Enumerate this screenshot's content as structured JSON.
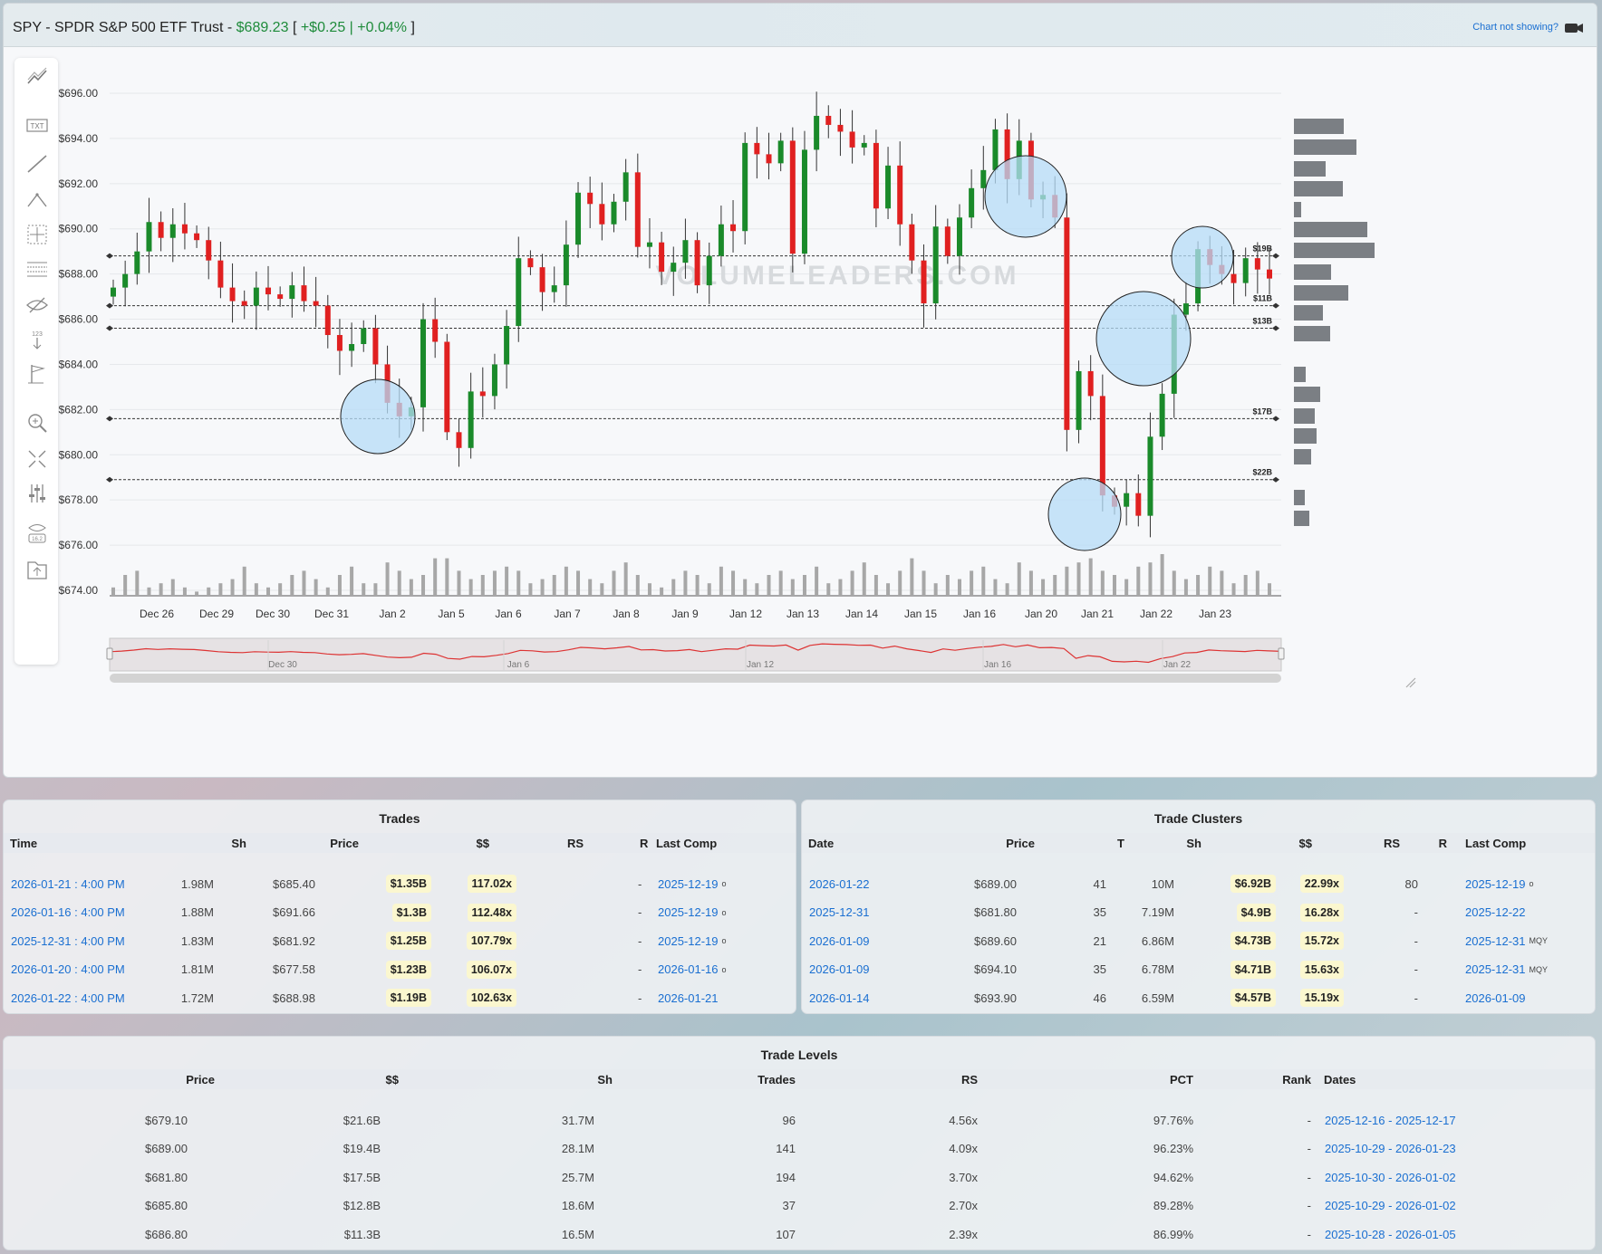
{
  "chart": {
    "symbol": "SPY",
    "name": "SPDR S&P 500 ETF Trust",
    "price": "$689.23",
    "change": "+$0.25",
    "change_pct": "+0.04%",
    "not_showing": "Chart not showing?",
    "watermark": "VOLUMELEADERS.COM",
    "colors": {
      "up": "#1a8a2a",
      "down": "#e02020",
      "bubble": "#b6dcf7",
      "volume": "#a7a7a7"
    }
  },
  "toolbar": [
    "trend-icon",
    "text-icon",
    "line-icon",
    "abc-pattern-icon",
    "crosshair-icon",
    "fib-lines-icon",
    "hide-eye-icon",
    "count-icon",
    "flag-icon",
    "zoom-icon",
    "fullscreen-icon",
    "settings-icon",
    "eye-value-icon",
    "export-icon"
  ],
  "chart_data": {
    "type": "candlestick",
    "y_ticks": [
      "$696.00",
      "$694.00",
      "$692.00",
      "$690.00",
      "$688.00",
      "$686.00",
      "$684.00",
      "$682.00",
      "$680.00",
      "$678.00",
      "$676.00",
      "$674.00"
    ],
    "ylim": [
      674,
      697
    ],
    "x_labels": [
      "Dec 26",
      "Dec 29",
      "Dec 30",
      "Dec 31",
      "Jan 2",
      "Jan 5",
      "Jan 6",
      "Jan 7",
      "Jan 8",
      "Jan 9",
      "Jan 12",
      "Jan 13",
      "Jan 14",
      "Jan 15",
      "Jan 16",
      "Jan 20",
      "Jan 21",
      "Jan 22",
      "Jan 23"
    ],
    "navigator_labels": [
      "Dec 30",
      "Jan 6",
      "Jan 12",
      "Jan 16",
      "Jan 22"
    ],
    "levels": [
      {
        "price": 688.8,
        "label": "$19B"
      },
      {
        "price": 686.6,
        "label": "$11B"
      },
      {
        "price": 685.6,
        "label": "$13B"
      },
      {
        "price": 681.6,
        "label": "$17B"
      },
      {
        "price": 678.9,
        "label": "$22B"
      }
    ],
    "closes": [
      687.4,
      688.0,
      689.0,
      690.3,
      689.6,
      690.2,
      689.8,
      689.5,
      688.6,
      687.4,
      686.8,
      686.6,
      687.4,
      687.1,
      686.9,
      687.5,
      686.8,
      686.6,
      685.3,
      684.6,
      684.9,
      685.6,
      684.0,
      682.3,
      681.7,
      682.1,
      686.0,
      685.0,
      681.0,
      680.3,
      682.8,
      682.6,
      684.0,
      685.7,
      688.7,
      688.3,
      687.2,
      687.5,
      689.3,
      691.6,
      691.1,
      690.2,
      691.2,
      692.5,
      689.2,
      689.4,
      688.1,
      688.5,
      689.5,
      687.5,
      688.8,
      690.2,
      689.9,
      693.8,
      693.3,
      692.9,
      693.9,
      688.9,
      693.5,
      695.0,
      694.6,
      694.3,
      693.6,
      693.8,
      690.9,
      692.8,
      690.2,
      688.6,
      686.7,
      690.1,
      688.8,
      690.5,
      691.8,
      692.6,
      694.4,
      692.2,
      693.9,
      691.3,
      691.5,
      690.5,
      681.1,
      683.7,
      682.6,
      678.2,
      677.7,
      678.3,
      677.3,
      680.8,
      682.7,
      686.2,
      686.7,
      689.1,
      688.4,
      688.0,
      687.6,
      688.7,
      688.2,
      687.8
    ],
    "volumes": [
      0.2,
      0.5,
      0.6,
      0.2,
      0.3,
      0.4,
      0.2,
      0.1,
      0.2,
      0.3,
      0.4,
      0.7,
      0.3,
      0.2,
      0.3,
      0.5,
      0.6,
      0.4,
      0.2,
      0.5,
      0.7,
      0.3,
      0.3,
      0.8,
      0.6,
      0.4,
      0.5,
      0.9,
      0.9,
      0.6,
      0.4,
      0.5,
      0.6,
      0.7,
      0.6,
      0.3,
      0.4,
      0.5,
      0.7,
      0.6,
      0.4,
      0.3,
      0.6,
      0.8,
      0.5,
      0.3,
      0.2,
      0.4,
      0.6,
      0.5,
      0.3,
      0.7,
      0.6,
      0.4,
      0.3,
      0.5,
      0.6,
      0.4,
      0.5,
      0.7,
      0.3,
      0.4,
      0.6,
      0.8,
      0.5,
      0.3,
      0.6,
      0.9,
      0.6,
      0.3,
      0.5,
      0.4,
      0.6,
      0.7,
      0.4,
      0.3,
      0.8,
      0.6,
      0.4,
      0.5,
      0.7,
      0.8,
      0.9,
      0.6,
      0.5,
      0.4,
      0.7,
      0.8,
      1.0,
      0.6,
      0.4,
      0.5,
      0.7,
      0.6,
      0.3,
      0.5,
      0.6,
      0.3
    ]
  },
  "trades": {
    "title": "Trades",
    "headers": [
      "Time",
      "Sh",
      "Price",
      "$$",
      "RS",
      "R",
      "Last Comp"
    ],
    "rows": [
      [
        "2026-01-21 : 4:00 PM",
        "1.98M",
        "$685.40",
        "$1.35B",
        "117.02x",
        "-",
        "2025-12-19",
        "o"
      ],
      [
        "2026-01-16 : 4:00 PM",
        "1.88M",
        "$691.66",
        "$1.3B",
        "112.48x",
        "-",
        "2025-12-19",
        "o"
      ],
      [
        "2025-12-31 : 4:00 PM",
        "1.83M",
        "$681.92",
        "$1.25B",
        "107.79x",
        "-",
        "2025-12-19",
        "o"
      ],
      [
        "2026-01-20 : 4:00 PM",
        "1.81M",
        "$677.58",
        "$1.23B",
        "106.07x",
        "-",
        "2026-01-16",
        "o"
      ],
      [
        "2026-01-22 : 4:00 PM",
        "1.72M",
        "$688.98",
        "$1.19B",
        "102.63x",
        "-",
        "2026-01-21",
        ""
      ]
    ]
  },
  "clusters": {
    "title": "Trade Clusters",
    "headers": [
      "Date",
      "Price",
      "T",
      "Sh",
      "$$",
      "RS",
      "R",
      "Last Comp"
    ],
    "rows": [
      [
        "2026-01-22",
        "$689.00",
        "41",
        "10M",
        "$6.92B",
        "22.99x",
        "80",
        "2025-12-19",
        "o"
      ],
      [
        "2025-12-31",
        "$681.80",
        "35",
        "7.19M",
        "$4.9B",
        "16.28x",
        "-",
        "2025-12-22",
        ""
      ],
      [
        "2026-01-09",
        "$689.60",
        "21",
        "6.86M",
        "$4.73B",
        "15.72x",
        "-",
        "2025-12-31",
        "MQY"
      ],
      [
        "2026-01-09",
        "$694.10",
        "35",
        "6.78M",
        "$4.71B",
        "15.63x",
        "-",
        "2025-12-31",
        "MQY"
      ],
      [
        "2026-01-14",
        "$693.90",
        "46",
        "6.59M",
        "$4.57B",
        "15.19x",
        "-",
        "2026-01-09",
        ""
      ]
    ]
  },
  "levels": {
    "title": "Trade Levels",
    "headers": [
      "Price",
      "$$",
      "Sh",
      "Trades",
      "RS",
      "PCT",
      "Rank",
      "Dates"
    ],
    "rows": [
      [
        "$679.10",
        "$21.6B",
        "31.7M",
        "96",
        "4.56x",
        "97.76%",
        "-",
        "2025-12-16 - 2025-12-17"
      ],
      [
        "$689.00",
        "$19.4B",
        "28.1M",
        "141",
        "4.09x",
        "96.23%",
        "-",
        "2025-10-29 - 2026-01-23"
      ],
      [
        "$681.80",
        "$17.5B",
        "25.7M",
        "194",
        "3.70x",
        "94.62%",
        "-",
        "2025-10-30 - 2026-01-02"
      ],
      [
        "$685.80",
        "$12.8B",
        "18.6M",
        "37",
        "2.70x",
        "89.28%",
        "-",
        "2025-10-29 - 2026-01-02"
      ],
      [
        "$686.80",
        "$11.3B",
        "16.5M",
        "107",
        "2.39x",
        "86.99%",
        "-",
        "2025-10-28 - 2026-01-05"
      ]
    ]
  }
}
